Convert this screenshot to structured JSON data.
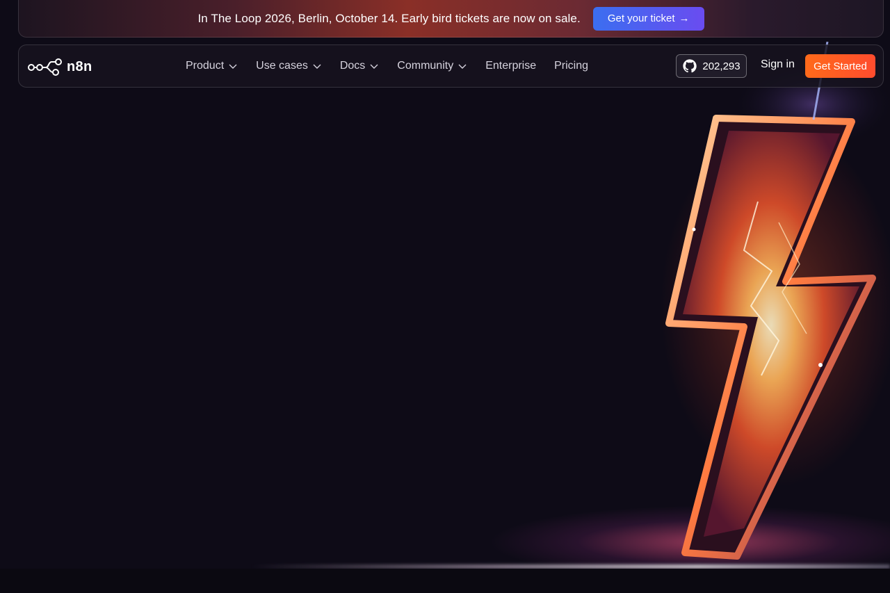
{
  "announcement": {
    "text": "In The Loop 2026, Berlin, October 14. Early bird tickets are now on sale.",
    "cta_label": "Get your ticket",
    "cta_arrow": "→"
  },
  "nav": {
    "logo_text": "n8n",
    "items": [
      {
        "label": "Product",
        "has_dropdown": true
      },
      {
        "label": "Use cases",
        "has_dropdown": true
      },
      {
        "label": "Docs",
        "has_dropdown": true
      },
      {
        "label": "Community",
        "has_dropdown": true
      },
      {
        "label": "Enterprise",
        "has_dropdown": false
      },
      {
        "label": "Pricing",
        "has_dropdown": false
      }
    ],
    "github_stars": "202,293",
    "signin_label": "Sign in",
    "get_started_label": "Get Started"
  },
  "icons": {
    "logo": "n8n-logo-icon",
    "github": "github-icon",
    "chevron": "chevron-down-icon",
    "hero": "lightning-bolt-icon"
  },
  "colors": {
    "background": "#0e0b17",
    "ticket_button": "#4a5ef0",
    "get_started": "#ff5a23",
    "bolt_fill": "#ff7a2a"
  }
}
